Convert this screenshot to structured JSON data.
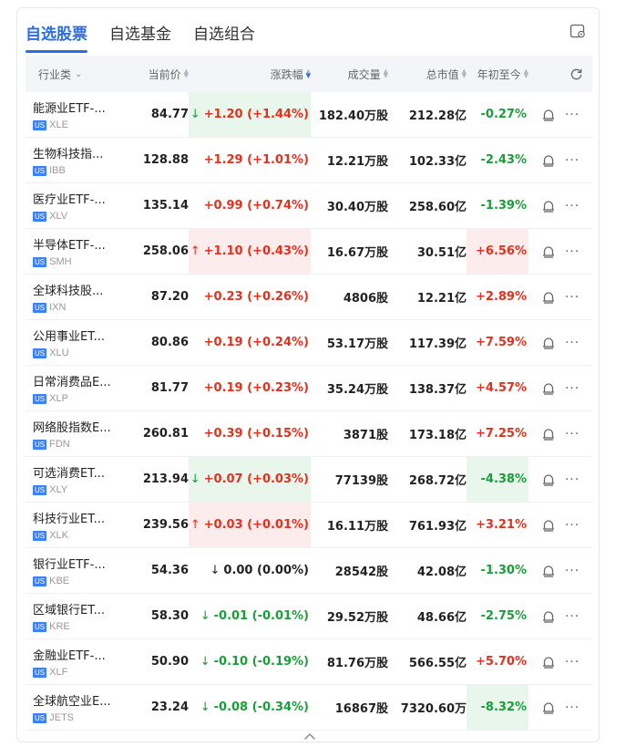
{
  "tabs": [
    "自选股票",
    "自选基金",
    "自选组合"
  ],
  "header": {
    "industry": "行业类",
    "price": "当前价",
    "change": "涨跌幅",
    "volume": "成交量",
    "market_cap": "总市值",
    "ytd": "年初至今"
  },
  "rows": [
    {
      "name": "能源业ETF-...",
      "market": "US",
      "symbol": "XLE",
      "price": "84.77",
      "change": "+1.20 (+1.44%)",
      "volume": "182.40万股",
      "market_cap": "212.28亿",
      "ytd": "-0.27%"
    },
    {
      "name": "生物科技指...",
      "market": "US",
      "symbol": "IBB",
      "price": "128.88",
      "change": "+1.29 (+1.01%)",
      "volume": "12.21万股",
      "market_cap": "102.33亿",
      "ytd": "-2.43%"
    },
    {
      "name": "医疗业ETF-...",
      "market": "US",
      "symbol": "XLV",
      "price": "135.14",
      "change": "+0.99 (+0.74%)",
      "volume": "30.40万股",
      "market_cap": "258.60亿",
      "ytd": "-1.39%"
    },
    {
      "name": "半导体ETF-...",
      "market": "US",
      "symbol": "SMH",
      "price": "258.06",
      "change": "+1.10 (+0.43%)",
      "volume": "16.67万股",
      "market_cap": "30.51亿",
      "ytd": "+6.56%"
    },
    {
      "name": "全球科技股...",
      "market": "US",
      "symbol": "IXN",
      "price": "87.20",
      "change": "+0.23 (+0.26%)",
      "volume": "4806股",
      "market_cap": "12.21亿",
      "ytd": "+2.89%"
    },
    {
      "name": "公用事业ET...",
      "market": "US",
      "symbol": "XLU",
      "price": "80.86",
      "change": "+0.19 (+0.24%)",
      "volume": "53.17万股",
      "market_cap": "117.39亿",
      "ytd": "+7.59%"
    },
    {
      "name": "日常消费品E...",
      "market": "US",
      "symbol": "XLP",
      "price": "81.77",
      "change": "+0.19 (+0.23%)",
      "volume": "35.24万股",
      "market_cap": "138.37亿",
      "ytd": "+4.57%"
    },
    {
      "name": "网络股指数E...",
      "market": "US",
      "symbol": "FDN",
      "price": "260.81",
      "change": "+0.39 (+0.15%)",
      "volume": "3871股",
      "market_cap": "173.18亿",
      "ytd": "+7.25%"
    },
    {
      "name": "可选消费ET...",
      "market": "US",
      "symbol": "XLY",
      "price": "213.94",
      "change": "+0.07 (+0.03%)",
      "volume": "77139股",
      "market_cap": "268.72亿",
      "ytd": "-4.38%"
    },
    {
      "name": "科技行业ET...",
      "market": "US",
      "symbol": "XLK",
      "price": "239.56",
      "change": "+0.03 (+0.01%)",
      "volume": "16.11万股",
      "market_cap": "761.93亿",
      "ytd": "+3.21%"
    },
    {
      "name": "银行业ETF-...",
      "market": "US",
      "symbol": "KBE",
      "price": "54.36",
      "change": "0.00 (0.00%)",
      "volume": "28542股",
      "market_cap": "42.08亿",
      "ytd": "-1.30%"
    },
    {
      "name": "区域银行ET...",
      "market": "US",
      "symbol": "KRE",
      "price": "58.30",
      "change": "-0.01 (-0.01%)",
      "volume": "29.52万股",
      "market_cap": "48.66亿",
      "ytd": "-2.75%"
    },
    {
      "name": "金融业ETF-...",
      "market": "US",
      "symbol": "XLF",
      "price": "50.90",
      "change": "-0.10 (-0.19%)",
      "volume": "81.76万股",
      "market_cap": "566.55亿",
      "ytd": "+5.70%"
    },
    {
      "name": "全球航空业E...",
      "market": "US",
      "symbol": "JETS",
      "price": "23.24",
      "change": "-0.08 (-0.34%)",
      "volume": "16867股",
      "market_cap": "7320.60万",
      "ytd": "-8.32%"
    }
  ],
  "row_styles": [
    {
      "change_color": "up",
      "change_bg": "down",
      "arrow": "↓",
      "ytd_color": "down",
      "ytd_bg": ""
    },
    {
      "change_color": "up",
      "change_bg": "",
      "arrow": "",
      "ytd_color": "down",
      "ytd_bg": ""
    },
    {
      "change_color": "up",
      "change_bg": "",
      "arrow": "",
      "ytd_color": "down",
      "ytd_bg": ""
    },
    {
      "change_color": "up",
      "change_bg": "up",
      "arrow": "↑",
      "ytd_color": "up",
      "ytd_bg": "up"
    },
    {
      "change_color": "up",
      "change_bg": "",
      "arrow": "",
      "ytd_color": "up",
      "ytd_bg": ""
    },
    {
      "change_color": "up",
      "change_bg": "",
      "arrow": "",
      "ytd_color": "up",
      "ytd_bg": ""
    },
    {
      "change_color": "up",
      "change_bg": "",
      "arrow": "",
      "ytd_color": "up",
      "ytd_bg": ""
    },
    {
      "change_color": "up",
      "change_bg": "",
      "arrow": "",
      "ytd_color": "up",
      "ytd_bg": ""
    },
    {
      "change_color": "up",
      "change_bg": "down",
      "arrow": "↓",
      "ytd_color": "down",
      "ytd_bg": "down"
    },
    {
      "change_color": "up",
      "change_bg": "up",
      "arrow": "↑",
      "ytd_color": "up",
      "ytd_bg": ""
    },
    {
      "change_color": "neutral",
      "change_bg": "",
      "arrow": "↓",
      "ytd_color": "down",
      "ytd_bg": ""
    },
    {
      "change_color": "down",
      "change_bg": "",
      "arrow": "↓",
      "ytd_color": "down",
      "ytd_bg": ""
    },
    {
      "change_color": "down",
      "change_bg": "",
      "arrow": "↓",
      "ytd_color": "up",
      "ytd_bg": ""
    },
    {
      "change_color": "down",
      "change_bg": "",
      "arrow": "↓",
      "ytd_color": "down",
      "ytd_bg": "down"
    }
  ],
  "colors": {
    "accent": "#2b6be4",
    "up": "#e0321f",
    "down": "#1a9e3a",
    "up_bg": "#fdecec",
    "down_bg": "#e8f6ec",
    "us_badge": "#3b82f6"
  },
  "icons": [
    "settings-icon",
    "refresh-icon",
    "bell-icon",
    "more-icon",
    "chevron-up-icon",
    "chevron-down-icon",
    "sort-icon"
  ]
}
